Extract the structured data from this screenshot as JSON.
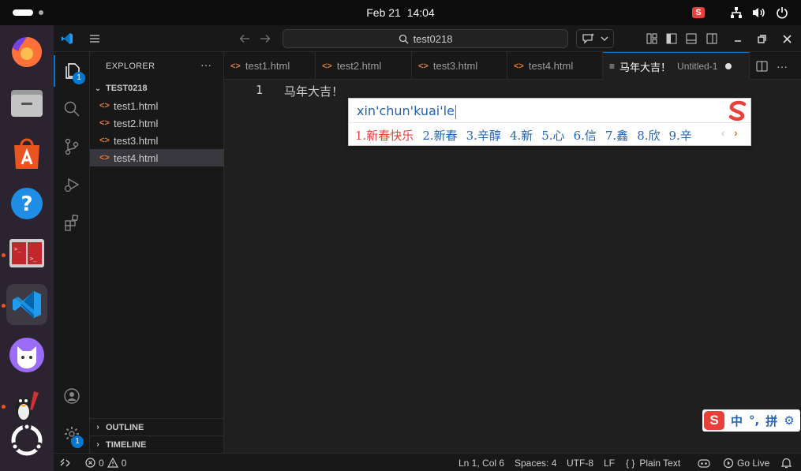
{
  "topbar": {
    "date": "Feb 21",
    "time": "14:04",
    "tray": [
      "sogou-icon",
      "network-icon",
      "volume-icon",
      "power-icon"
    ]
  },
  "dock": {
    "apps": [
      "firefox",
      "files",
      "app-center",
      "help",
      "terminal-app",
      "vscode",
      "cat-app",
      "gimp",
      "ubuntu-show-apps"
    ]
  },
  "titlebar": {
    "command_center": "test0218"
  },
  "activitybar": {
    "explorer_badge": "1",
    "settings_badge": "1"
  },
  "sidebar": {
    "title": "EXPLORER",
    "more": "···",
    "folder": "TEST0218",
    "files": [
      {
        "name": "test1.html"
      },
      {
        "name": "test2.html"
      },
      {
        "name": "test3.html"
      },
      {
        "name": "test4.html"
      }
    ],
    "outline": "OUTLINE",
    "timeline": "TIMELINE"
  },
  "tabs": [
    {
      "label": "test1.html"
    },
    {
      "label": "test2.html"
    },
    {
      "label": "test3.html"
    },
    {
      "label": "test4.html"
    },
    {
      "label": "马年大吉！",
      "sub": "Untitled-1"
    }
  ],
  "file_icon_glyph": "<>",
  "editor": {
    "line_number": "1",
    "line_text": "马年大吉！"
  },
  "ime": {
    "composition": "xin'chun'kuai'le",
    "candidates": [
      "1.新春快乐",
      "2.新春",
      "3.辛醇",
      "4.新",
      "5.心",
      "6.信",
      "7.鑫",
      "8.欣",
      "9.辛"
    ],
    "prev": "‹",
    "next": "›"
  },
  "sogou_bar": {
    "logo": "S",
    "mode": "中",
    "punct": "°,",
    "pinyin": "拼",
    "settings": "⚙"
  },
  "statusbar": {
    "errors": "0",
    "warnings": "0",
    "position": "Ln 1, Col 6",
    "spaces": "Spaces: 4",
    "encoding": "UTF-8",
    "eol": "LF",
    "language_braces": "{ }",
    "language": "Plain Text",
    "golive": "Go Live"
  },
  "colors": {
    "accent": "#0078d4",
    "ime_blue": "#2364b8",
    "ime_red": "#e8413a",
    "html_icon": "#e37933"
  }
}
